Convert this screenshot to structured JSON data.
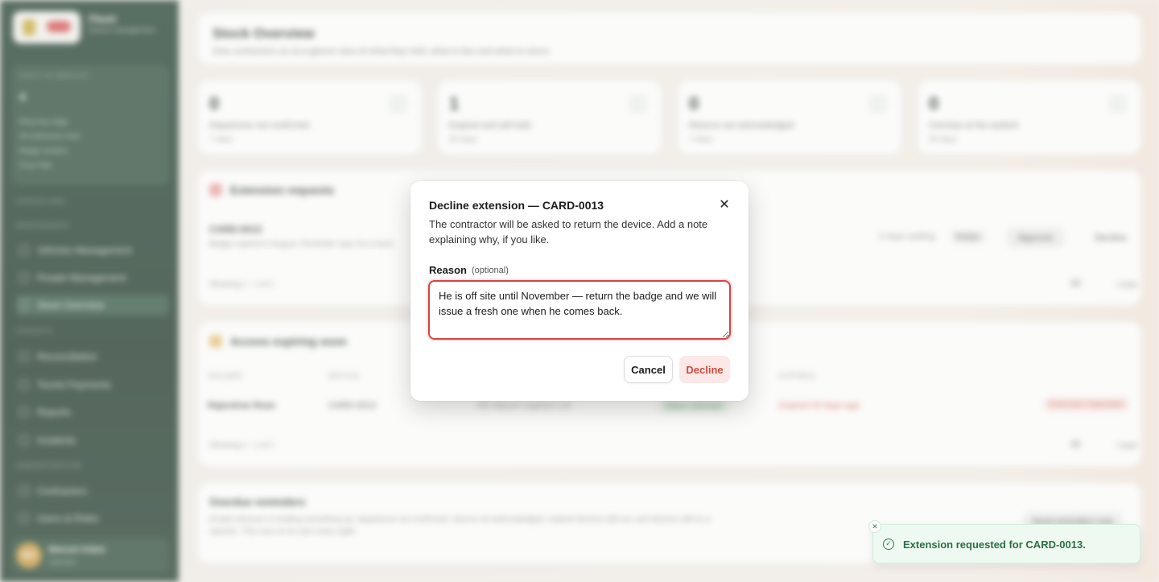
{
  "sidebar": {
    "brand_name": "Fleetr",
    "brand_sub": "Device management",
    "card_title": "SHIFT IN SERVICE",
    "card_value": "4",
    "card_items": [
      "Ring stop ridge",
      "All extensions here",
      "Badge vendors",
      "Drop Hale"
    ],
    "sections": [
      "OPERATIONS",
      "MANAGEMENT",
      "INSIGHTS",
      "ADMINISTRATION"
    ],
    "items": [
      "Vehicles Management",
      "People Management",
      "Stock Overview",
      "Reconciliation",
      "Tourist Payments",
      "Reports",
      "Incidents",
      "Contractors",
      "Users & Roles"
    ],
    "user_initials": "MO",
    "user_name": "Manuel Adam",
    "user_role": "Operator"
  },
  "main": {
    "header_title": "Stock Overview",
    "header_sub": "Give contractors an at-a-glance view of what they hold, what is due and what to return.",
    "stats": [
      {
        "value": "0",
        "label": "Departures not confirmed",
        "sub": "7 days"
      },
      {
        "value": "1",
        "label": "Expired and still held",
        "sub": "30 days"
      },
      {
        "value": "0",
        "label": "Returns not acknowledged",
        "sub": "7 days"
      },
      {
        "value": "0",
        "label": "Overdue at the earliest",
        "sub": "30 days"
      }
    ],
    "extension": {
      "title": "Extension requests",
      "row_title": "CARD-0013",
      "row_sub": "Badge expired in August. Reminder says he is back",
      "waiting": "3 days waiting",
      "pill": "Badge",
      "approve": "Approve",
      "decline": "Decline",
      "showing": "Showing 1 - 1 of 1",
      "per_page": "10",
      "page_label": "/ page"
    },
    "expiring": {
      "title": "Access expiring soon",
      "cols": [
        "HOLDER",
        "DEVICE",
        "EXPIRES"
      ],
      "holder": "Rajendran Roan",
      "device": "CARD-0013",
      "company": "EE Marcel Logistics Ltd",
      "status": "Status unknown",
      "expired": "Expired 40 days ago",
      "requested": "Extension requested",
      "showing": "Showing 1 - 1 of 1",
      "per_page": "10",
      "page_label": "/ page"
    },
    "overdue": {
      "title": "Overdue reminders",
      "text": "Emails whoever is holding something up: departures not confirmed, returns not acknowledged, expired devices still out, and devices still on a reporter. This runs on its own every night.",
      "button": "Send reminders now"
    }
  },
  "modal": {
    "title": "Decline extension — CARD-0013",
    "description": "The contractor will be asked to return the device. Add a note explaining why, if you like.",
    "reason_label": "Reason",
    "reason_optional": "(optional)",
    "reason_value": "He is off site until November — return the badge and we will issue a fresh one when he comes back.",
    "cancel_label": "Cancel",
    "decline_label": "Decline",
    "close_glyph": "✕"
  },
  "toast": {
    "message": "Extension requested for CARD-0013.",
    "close_glyph": "✕",
    "icon_glyph": "✓"
  }
}
